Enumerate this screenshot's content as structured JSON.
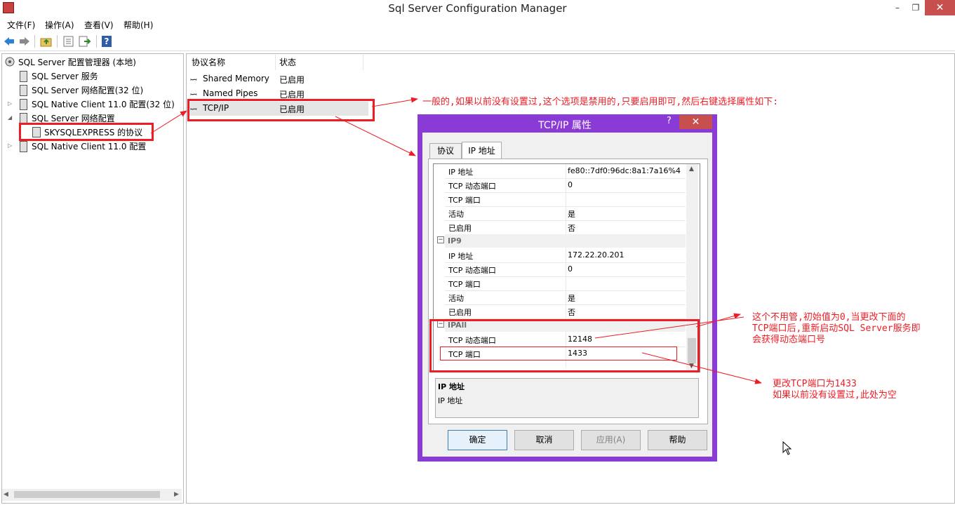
{
  "window": {
    "title": "Sql Server Configuration Manager",
    "min_label": "–",
    "max_label": "❐",
    "close_label": "✕"
  },
  "menubar": [
    "文件(F)",
    "操作(A)",
    "查看(V)",
    "帮助(H)"
  ],
  "toolbar": {
    "icons": [
      "back-arrow-icon",
      "forward-arrow-icon",
      "up-folder-icon",
      "properties-icon",
      "export-list-icon",
      "help-icon"
    ],
    "help_glyph": "?"
  },
  "tree": {
    "root": "SQL Server 配置管理器 (本地)",
    "items": [
      {
        "label": "SQL Server 服务"
      },
      {
        "label": "SQL Server 网络配置(32 位)"
      },
      {
        "label": "SQL Native Client 11.0 配置(32 位)"
      },
      {
        "label": "SQL Server 网络配置"
      },
      {
        "label": "SKYSQLEXPRESS 的协议"
      },
      {
        "label": "SQL Native Client 11.0 配置"
      }
    ]
  },
  "protocols": {
    "columns": [
      "协议名称",
      "状态"
    ],
    "rows": [
      {
        "name": "Shared Memory",
        "status": "已启用"
      },
      {
        "name": "Named Pipes",
        "status": "已启用"
      },
      {
        "name": "TCP/IP",
        "status": "已启用"
      }
    ]
  },
  "dialog": {
    "title": "TCP/IP 属性",
    "help_glyph": "?",
    "close_glyph": "✕",
    "tabs": [
      "协议",
      "IP 地址"
    ],
    "active_tab": "IP 地址",
    "rows": [
      {
        "label": "IP 地址",
        "value": "fe80::7df0:96dc:8a1:7a16%4"
      },
      {
        "label": "TCP 动态端口",
        "value": "0"
      },
      {
        "label": "TCP 端口",
        "value": ""
      },
      {
        "label": "活动",
        "value": "是"
      },
      {
        "label": "已启用",
        "value": "否"
      }
    ],
    "ip9": {
      "header": "IP9",
      "rows": [
        {
          "label": "IP 地址",
          "value": "172.22.20.201"
        },
        {
          "label": "TCP 动态端口",
          "value": "0"
        },
        {
          "label": "TCP 端口",
          "value": ""
        },
        {
          "label": "活动",
          "value": "是"
        },
        {
          "label": "已启用",
          "value": "否"
        }
      ]
    },
    "ipall": {
      "header": "IPAll",
      "rows": [
        {
          "label": "TCP 动态端口",
          "value": "12148"
        },
        {
          "label": "TCP 端口",
          "value": "1433"
        }
      ]
    },
    "description": {
      "title": "IP 地址",
      "text": "IP 地址"
    },
    "buttons": {
      "ok": "确定",
      "cancel": "取消",
      "apply": "应用(A)",
      "help": "帮助"
    }
  },
  "annotations": {
    "top": "一般的,如果以前没有设置过,这个选项是禁用的,只要启用即可,然后右键选择属性如下:",
    "dynamic_port_1": "这个不用管,初始值为0,当更改下面的",
    "dynamic_port_2": "TCP端口后,重新启动SQL Server服务即",
    "dynamic_port_3": "会获得动态端口号",
    "tcp_port_1": "更改TCP端口为1433",
    "tcp_port_2": "如果以前没有设置过,此处为空",
    "color": "#ee1c24"
  }
}
